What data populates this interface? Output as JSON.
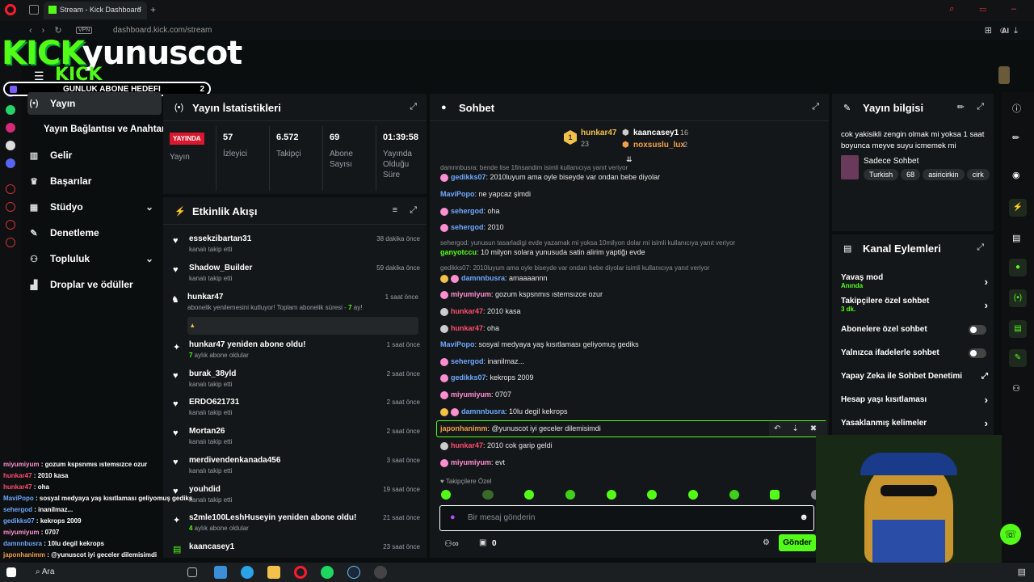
{
  "browser": {
    "tab_title": "Stream - Kick Dashboard",
    "vpn": "VPN",
    "url": "dashboard.kick.com/stream",
    "ai_label": "AI"
  },
  "overlay": {
    "logo_kick": "KICK",
    "logo_user": "yunuscot",
    "logo_kick2": "KICK",
    "goal_label": "GUNLUK ABONE HEDEFI",
    "goal_count": "2"
  },
  "nav": [
    {
      "label": "Yayın",
      "icon": "radio-icon"
    },
    {
      "label": "Yayın Bağlantısı ve Anahtarı",
      "icon": ""
    },
    {
      "label": "Gelir",
      "icon": "chart-icon"
    },
    {
      "label": "Başarılar",
      "icon": "trophy-icon"
    },
    {
      "label": "Stüdyo",
      "icon": "studio-icon"
    },
    {
      "label": "Denetleme",
      "icon": "wrench-icon"
    },
    {
      "label": "Topluluk",
      "icon": "community-icon"
    },
    {
      "label": "Droplar ve ödüller",
      "icon": "gift-icon"
    }
  ],
  "stats": {
    "title": "Yayın İstatistikleri",
    "live_badge": "YAYINDA",
    "live_label": "Yayın",
    "viewers": "57",
    "viewers_label": "İzleyici",
    "followers": "6.572",
    "followers_label": "Takipçi",
    "subs": "69",
    "subs_label": "Abone Sayısı",
    "uptime": "01:39:58",
    "uptime_label": "Yayında Olduğu Süre"
  },
  "activity": {
    "title": "Etkinlik Akışı",
    "items": [
      {
        "name": "essekzibartan31",
        "sub": "kanalı takip etti",
        "time": "38 dakika önce"
      },
      {
        "name": "Shadow_Builder",
        "sub": "kanalı takip etti",
        "time": "59 dakika önce"
      },
      {
        "name": "hunkar47",
        "sub": "abonelik yenilemesini kutluyor! Toplam abonelik süresi - ",
        "sub_hl": "7",
        "sub_end": " ay!",
        "time": "1 saat önce"
      },
      {
        "name": "hunkar47 yeniden abone oldu!",
        "sub_hl": "7",
        "sub": " aylık abone oldular",
        "time": "1 saat önce"
      },
      {
        "name": "burak_38yld",
        "sub": "kanalı takip etti",
        "time": "2 saat önce"
      },
      {
        "name": "ERDO621731",
        "sub": "kanalı takip etti",
        "time": "2 saat önce"
      },
      {
        "name": "Mortan26",
        "sub": "kanalı takip etti",
        "time": "2 saat önce"
      },
      {
        "name": "merdivendenkanada456",
        "sub": "kanalı takip etti",
        "time": "3 saat önce"
      },
      {
        "name": "youhdid",
        "sub": "kanalı takip etti",
        "time": "19 saat önce"
      },
      {
        "name": "s2mle100LeshHuseyin yeniden abone oldu!",
        "sub_hl": "4",
        "sub": " aylık abone oldular",
        "time": "21 saat önce"
      },
      {
        "name": "kaancasey1",
        "sub": "",
        "time": "23 saat önce"
      }
    ]
  },
  "chat": {
    "title": "Sohbet",
    "top": [
      {
        "rank": "1",
        "name": "hunkar47",
        "count": "23"
      },
      {
        "rank": "",
        "name": "kaancasey1",
        "count": "16"
      },
      {
        "rank": "",
        "name": "noxsuslu_lux",
        "count": "2"
      }
    ],
    "messages": [
      {
        "reply": "damnnbusra: bende lise 1finsandim isimli kullanıcıya yanıt veriyor"
      },
      {
        "user": "gedikks07",
        "color": "c-blue",
        "text": ": 2010luyum ama oyle biseyde var ondan bebe diyolar"
      },
      {
        "user": "MaviPopo",
        "color": "c-blue",
        "text": ": ne yapcaz şimdi"
      },
      {
        "user": "sehergod",
        "color": "c-blue",
        "text": ": oha"
      },
      {
        "user": "sehergod",
        "color": "c-blue",
        "text": ": 2010"
      },
      {
        "reply": "sehergod: yunusun tasarladigi evde yazamak mi yoksa 10milyon dolar mi isimli kullanıcıya yanıt veriyor"
      },
      {
        "user": "ganyotccu",
        "color": "c-green",
        "text": ": 10 milyon solara yunusuda satin alirim yaptiğı evde"
      },
      {
        "reply": "gedikks07: 2010luyum ama oyle biseyde var ondan bebe diyolar isimli kullanıcıya yanıt veriyor"
      },
      {
        "user": "damnnbusra",
        "color": "c-blue",
        "text": ": amaaaannn"
      },
      {
        "user": "miyumiyum",
        "color": "c-pink",
        "text": ": gozum kspsnmıs ıstemsızce ozur"
      },
      {
        "user": "hunkar47",
        "color": "c-red",
        "text": ": 2010 kasa"
      },
      {
        "user": "hunkar47",
        "color": "c-red",
        "text": ": oha"
      },
      {
        "user": "MaviPopo",
        "color": "c-blue",
        "text": ": sosyal medyaya yaş kısıtlaması geliyomuş gediks"
      },
      {
        "user": "sehergod",
        "color": "c-blue",
        "text": ": inanilmaz..."
      },
      {
        "user": "gedikks07",
        "color": "c-blue",
        "text": ": kekrops 2009"
      },
      {
        "user": "miyumiyum",
        "color": "c-pink",
        "text": ": 0707"
      },
      {
        "user": "damnnbusra",
        "color": "c-blue",
        "text": ": 10lu degil kekrops"
      },
      {
        "user": "japonhanimm",
        "color": "c-orange",
        "text": ": @yunuscot iyi geceler dilemisimdi"
      },
      {
        "user": "hunkar47",
        "color": "c-red",
        "text": ": 2010 cok garip geldi"
      },
      {
        "user": "miyumiyum",
        "color": "c-pink",
        "text": ": evt"
      }
    ],
    "followers_only": "Takipçilere Özel",
    "input_placeholder": "Bir mesaj gönderin",
    "send": "Gönder",
    "points": "0"
  },
  "info": {
    "title": "Yayın bilgisi",
    "stream_title": "cok yakisikli zengin olmak mi yoksa 1 saat boyunca meyve suyu icmemek mi",
    "category": "Sadece Sohbet",
    "tags": [
      "Turkish",
      "68",
      "asiricirkin",
      "cirk"
    ]
  },
  "channel_actions": {
    "title": "Kanal Eylemleri",
    "slow_mode": "Yavaş mod",
    "slow_mode_val": "Anında",
    "followers_chat": "Takipçilere özel sohbet",
    "followers_chat_val": "3 dk.",
    "subs_chat": "Abonelere özel sohbet",
    "emotes_chat": "Yalnızca ifadelerle sohbet",
    "ai_mod": "Yapay Zeka ile Sohbet Denetimi",
    "age": "Hesap yaşı kısıtlaması",
    "banned": "Yasaklanmış kelimeler"
  },
  "overlay_chat": [
    {
      "u": "miyumiyum",
      "c": "#ff8fd0",
      "t": " : gozum kspsnmıs ıstemsızce ozur"
    },
    {
      "u": "hunkar47",
      "c": "#ff4d6d",
      "t": " : 2010 kasa"
    },
    {
      "u": "hunkar47",
      "c": "#ff4d6d",
      "t": " : oha"
    },
    {
      "u": "MaviPopo",
      "c": "#6ea8ff",
      "t": " : sosyal medyaya yaş kısıtlaması geliyomuş gediks"
    },
    {
      "u": "sehergod",
      "c": "#6ea8ff",
      "t": " : inanilmaz..."
    },
    {
      "u": "gedikks07",
      "c": "#6ea8ff",
      "t": " : kekrops 2009"
    },
    {
      "u": "miyumiyum",
      "c": "#ff8fd0",
      "t": " : 0707"
    },
    {
      "u": "damnnbusra",
      "c": "#6ea8ff",
      "t": " : 10lu degil kekrops"
    },
    {
      "u": "japonhanimm",
      "c": "#f2a14a",
      "t": " : @yunuscot iyi geceler dilemisimdi"
    }
  ],
  "taskbar": {
    "search": "Ara"
  }
}
